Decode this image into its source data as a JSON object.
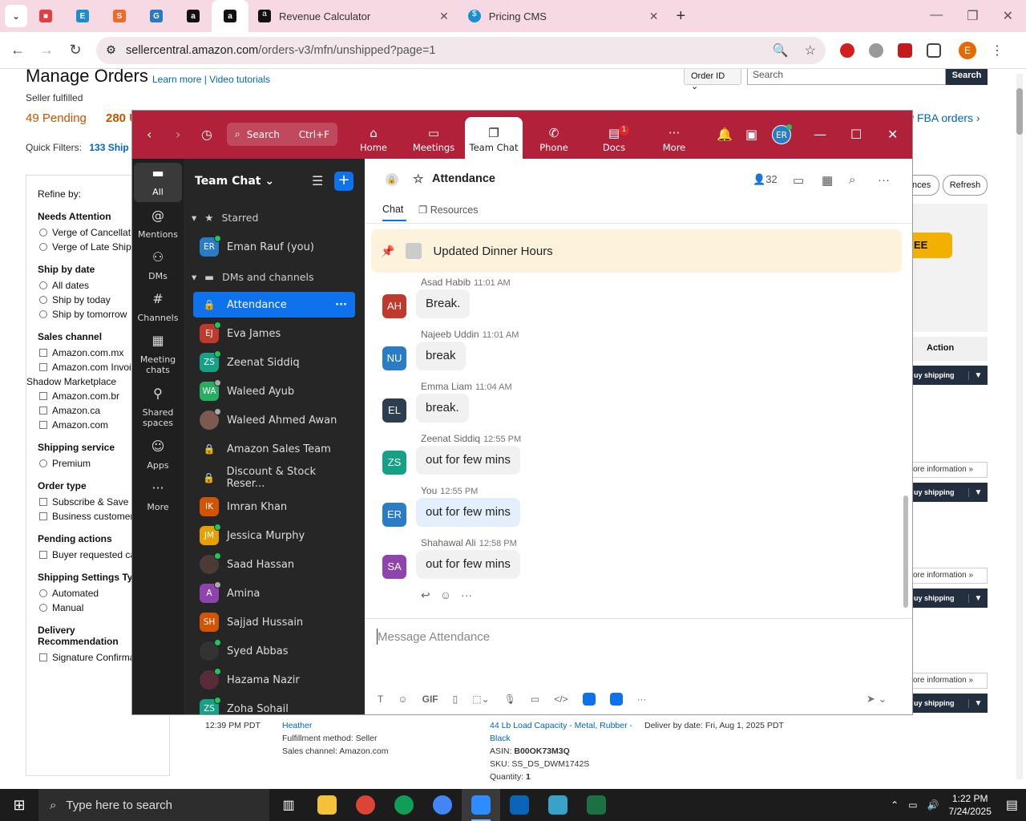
{
  "browser": {
    "tabs": [
      {
        "label": "Revenue Calculator"
      },
      {
        "label": "Pricing CMS"
      }
    ],
    "url_host": "sellercentral.amazon.com",
    "url_path": "/orders-v3/mfn/unshipped?page=1",
    "profile_initial": "E"
  },
  "amazon": {
    "title": "Manage Orders",
    "learn_more": "Learn more",
    "video_tutorials": "Video tutorials",
    "seller_fulfilled": "Seller fulfilled",
    "pending": "49 Pending",
    "unshipped": "280 U",
    "quick_filters": "Quick Filters:",
    "quick_filter_count": "133 Ship b",
    "order_id_select": "Order ID",
    "search_placeholder": "Search",
    "search_button": "Search",
    "fba_link": "w FBA orders",
    "preferences_button": "nces",
    "refresh_button": "Refresh",
    "action_header": "Action",
    "buy_shipping": "uy shipping",
    "more_information": "ore information",
    "refine_by": "Refine by:",
    "filters": [
      {
        "header": "Needs Attention",
        "kind": "radio",
        "options": [
          "Verge of Cancellatio",
          "Verge of Late Shipm"
        ]
      },
      {
        "header": "Ship by date",
        "kind": "radio",
        "options": [
          "All dates",
          "Ship by today",
          "Ship by tomorrow"
        ]
      },
      {
        "header": "Sales channel",
        "kind": "check",
        "options": [
          "Amazon.com.mx",
          "Amazon.com Invoici",
          "Shadow Marketplace",
          "Amazon.com.br",
          "Amazon.ca",
          "Amazon.com"
        ]
      },
      {
        "header": "Shipping service",
        "kind": "radio",
        "options": [
          "Premium"
        ]
      },
      {
        "header": "Order type",
        "kind": "check",
        "options": [
          "Subscribe & Save",
          "Business customer"
        ]
      },
      {
        "header": "Pending actions",
        "kind": "check",
        "options": [
          "Buyer requested can"
        ]
      },
      {
        "header": "Shipping Settings Type",
        "kind": "radio",
        "options": [
          "Automated",
          "Manual"
        ]
      },
      {
        "header": "Delivery Recommendation",
        "kind": "check",
        "options": [
          "Signature Confirmation"
        ]
      }
    ],
    "bottom_row": {
      "time": "12:39 PM PDT",
      "buyer": "Heather",
      "fulfillment": "Fulfillment method: Seller",
      "sales_channel": "Sales channel: Amazon.com",
      "product_line1": "44 Lb Load Capacity - Metal, Rubber -",
      "product_line2": "Black",
      "asin_label": "ASIN:",
      "asin": "B00OK73M3Q",
      "sku": "SKU: SS_DS_DWM1742S",
      "qty_label": "Quantity:",
      "qty": "1",
      "deliver_by": "Deliver by date: Fri, Aug 1, 2025 PDT"
    }
  },
  "zoom": {
    "search_label": "Search",
    "search_shortcut": "Ctrl+F",
    "tabs": [
      {
        "label": "Home",
        "icon": "home-icon"
      },
      {
        "label": "Meetings",
        "icon": "video-icon"
      },
      {
        "label": "Team Chat",
        "icon": "chat-icon"
      },
      {
        "label": "Phone",
        "icon": "phone-icon"
      },
      {
        "label": "Docs",
        "icon": "docs-icon",
        "badge": "1"
      },
      {
        "label": "More",
        "icon": "more-icon"
      }
    ],
    "user_initials": "ER",
    "sidebar": [
      {
        "label": "All",
        "icon": "chat-bubble-icon"
      },
      {
        "label": "Mentions",
        "icon": "at-icon"
      },
      {
        "label": "DMs",
        "icon": "people-icon"
      },
      {
        "label": "Channels",
        "icon": "hash-icon"
      },
      {
        "label": "Meeting chats",
        "icon": "calendar-icon"
      },
      {
        "label": "Shared spaces",
        "icon": "share-icon"
      },
      {
        "label": "Apps",
        "icon": "apps-icon"
      },
      {
        "label": "More",
        "icon": "more-icon"
      }
    ],
    "list_title": "Team Chat",
    "starred_label": "Starred",
    "starred_item": {
      "initials": "ER",
      "name": "Eman Rauf (you)",
      "color": "#2a7cc7"
    },
    "dms_label": "DMs and channels",
    "channels": [
      {
        "name": "Attendance",
        "type": "lock"
      },
      {
        "name": "Eva James",
        "initials": "EJ",
        "color": "#c0392b",
        "status": "online"
      },
      {
        "name": "Zeenat Siddiq",
        "initials": "ZS",
        "color": "#16a085",
        "status": "online"
      },
      {
        "name": "Waleed Ayub",
        "initials": "WA",
        "color": "#27ae60",
        "status": "away"
      },
      {
        "name": "Waleed Ahmed Awan",
        "initials": "",
        "color": "#7d5a50",
        "status": "away"
      },
      {
        "name": "Amazon Sales Team",
        "type": "lock"
      },
      {
        "name": "Discount & Stock Reser...",
        "type": "lock"
      },
      {
        "name": "Imran Khan",
        "initials": "IK",
        "color": "#d35400",
        "status": "none"
      },
      {
        "name": "Jessica Murphy",
        "initials": "JM",
        "color": "#e6a000",
        "status": "online"
      },
      {
        "name": "Saad Hassan",
        "initials": "",
        "color": "#4a3b35",
        "status": "online"
      },
      {
        "name": "Amina",
        "initials": "A",
        "color": "#8e44ad",
        "status": "away"
      },
      {
        "name": "Sajjad Hussain",
        "initials": "SH",
        "color": "#d35400",
        "status": "none"
      },
      {
        "name": "Syed Abbas",
        "initials": "",
        "color": "#333333",
        "status": "online"
      },
      {
        "name": "Hazama Nazir",
        "initials": "",
        "color": "#5a2c3a",
        "status": "online"
      },
      {
        "name": "Zoha Sohail",
        "initials": "ZS",
        "color": "#16a085",
        "status": "online"
      }
    ],
    "channel_title": "Attendance",
    "member_count": "32",
    "subtab_chat": "Chat",
    "subtab_resources": "Resources",
    "pinned_message": "Updated Dinner Hours",
    "messages": [
      {
        "initials": "AH",
        "color": "#c0392b",
        "sender": "Asad Habib",
        "time": "11:01 AM",
        "text": "Break."
      },
      {
        "initials": "NU",
        "color": "#2a7cc7",
        "sender": "Najeeb Uddin",
        "time": "11:01 AM",
        "text": "break"
      },
      {
        "initials": "EL",
        "color": "#2c3e50",
        "sender": "Emma Liam",
        "time": "11:04 AM",
        "text": "break."
      },
      {
        "initials": "ZS",
        "color": "#16a085",
        "sender": "Zeenat Siddiq",
        "time": "12:55 PM",
        "text": "out for few mins"
      },
      {
        "initials": "ER",
        "color": "#2a7cc7",
        "sender": "You",
        "time": "12:55 PM",
        "text": "out for few mins",
        "me": true
      },
      {
        "initials": "SA",
        "color": "#8e44ad",
        "sender": "Shahawal Ali",
        "time": "12:58 PM",
        "text": "out for few mins"
      }
    ],
    "composer_placeholder": "Message Attendance",
    "composer_tools": [
      "T",
      "☺",
      "GIF"
    ]
  },
  "taskbar": {
    "search_placeholder": "Type here to search",
    "time": "1:22 PM",
    "date": "7/24/2025"
  }
}
